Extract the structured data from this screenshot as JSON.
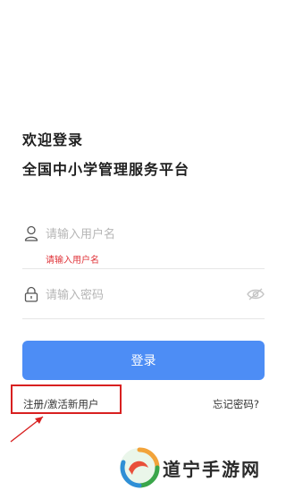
{
  "header": {
    "welcome": "欢迎登录",
    "subtitle": "全国中小学管理服务平台"
  },
  "form": {
    "username": {
      "placeholder": "请输入用户名",
      "value": "",
      "error": "请输入用户名",
      "icon": "user-icon"
    },
    "password": {
      "placeholder": "请输入密码",
      "value": "",
      "icon": "lock-icon",
      "toggle_icon": "eye-icon"
    },
    "login_label": "登录"
  },
  "links": {
    "register": "注册/激活新用户",
    "forgot": "忘记密码?"
  },
  "watermark": {
    "text": "道宁手游网"
  },
  "colors": {
    "primary": "#4d8df5",
    "error": "#e0343a",
    "highlight": "#d82020"
  }
}
